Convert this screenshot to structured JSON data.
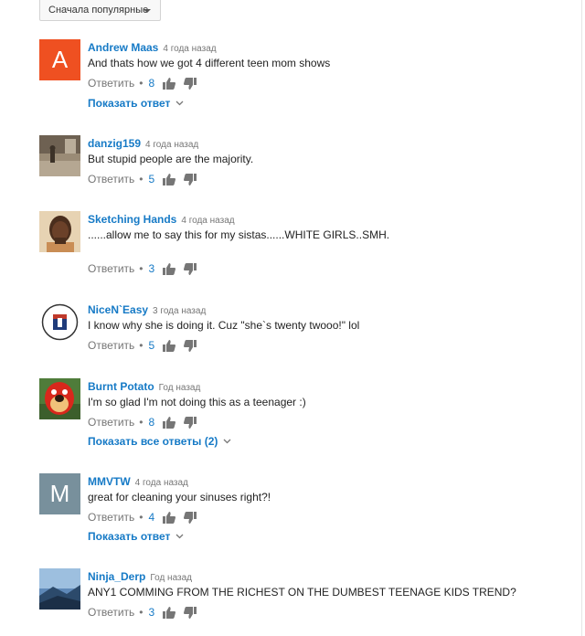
{
  "sort": {
    "label": "Сначала популярные"
  },
  "reply_label": "Ответить",
  "comments": [
    {
      "author": "Andrew Maas",
      "time": "4 года назад",
      "text": "And thats how we got 4 different teen mom shows",
      "likes": "8",
      "avatar_letter": "A",
      "avatar_color": "#ef5021",
      "replies_label": "Показать ответ"
    },
    {
      "author": "danzig159",
      "time": "4 года назад",
      "text": "But stupid people are the majority.",
      "likes": "5"
    },
    {
      "author": "Sketching Hands",
      "time": "4 года назад",
      "text": "......allow me to say this for my sistas......WHITE GIRLS..SMH.",
      "likes": "3"
    },
    {
      "author": "NiceN`Easy",
      "time": "3 года назад",
      "text": "I know why she is doing it. Cuz \"she`s twenty twooo!\" lol",
      "likes": "5"
    },
    {
      "author": "Burnt Potato",
      "time": "Год назад",
      "text": "I'm so glad I'm not doing this as a teenager :)",
      "likes": "8",
      "replies_label": "Показать все ответы (2)"
    },
    {
      "author": "MMVTW",
      "time": "4 года назад",
      "text": "great for cleaning your sinuses right?!",
      "likes": "4",
      "avatar_letter": "M",
      "avatar_color": "#78909c",
      "replies_label": "Показать ответ"
    },
    {
      "author": "Ninja_Derp",
      "time": "Год назад",
      "text": "ANY1 COMMING FROM THE RICHEST ON THE DUMBEST TEENAGE KIDS TREND?",
      "likes": "3"
    }
  ],
  "icons": {
    "like": "thumbs-up-icon",
    "dislike": "thumbs-down-icon",
    "expand": "chevron-down-icon"
  },
  "colors": {
    "link": "#167ac6",
    "meta": "#767676"
  }
}
